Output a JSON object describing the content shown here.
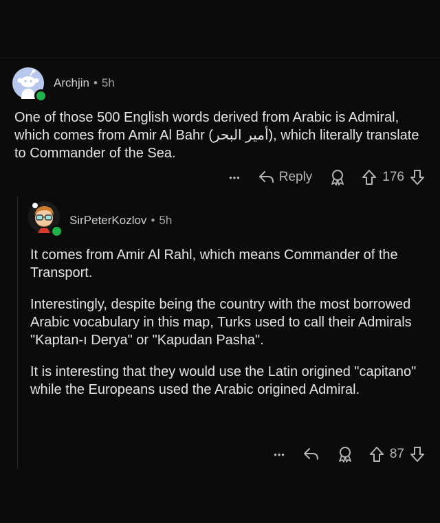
{
  "parent_comment": {
    "author": "Archjin",
    "age": "5h",
    "separator": "•",
    "text_before": "One of those 500 English words derived from Arabic is Admiral, which comes from Amir Al Bahr (",
    "arabic_phrase": "أمير البحر",
    "text_after": "), which literally translate to Commander of the Sea.",
    "actions": {
      "more_label": "•••",
      "reply_label": "Reply",
      "vote_count": "176"
    }
  },
  "reply_comment": {
    "author": "SirPeterKozlov",
    "age": "5h",
    "separator": "•",
    "paragraphs": [
      "It comes from Amir Al Rahl, which means Commander of the Transport.",
      "Interestingly, despite being the country with the most borrowed Arabic vocabulary in this map, Turks used to call their Admirals \"Kaptan-ı Derya\" or \"Kapudan Pasha\".",
      "It is interesting that they would use the Latin origined \"capitano\" while the Europeans used the Arabic origined Admiral."
    ],
    "actions": {
      "more_label": "•••",
      "vote_count": "87"
    }
  },
  "colors": {
    "background": "#0b0b0b",
    "online": "#1fb24a",
    "meta_text": "#a4a4a4",
    "body_text": "#e4e4e4"
  }
}
